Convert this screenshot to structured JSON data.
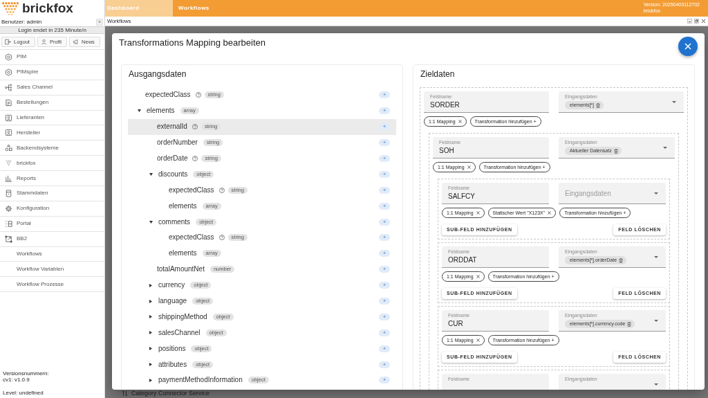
{
  "sidebar": {
    "logo": "brickfox",
    "user": "Benutzer: admin",
    "collapse": "«",
    "session": "Login endet in 235 Minute/n",
    "buttons": [
      "Logout",
      "Profil",
      "News"
    ],
    "nav": [
      {
        "label": "PIM",
        "selected": false
      },
      {
        "label": "PIMspire",
        "selected": false
      },
      {
        "label": "Sales Channel",
        "selected": false
      },
      {
        "label": "Bestellungen",
        "selected": false
      },
      {
        "label": "Lieferanten",
        "selected": false
      },
      {
        "label": "Hersteller",
        "selected": false
      },
      {
        "label": "Backendsysteme",
        "selected": false
      },
      {
        "label": "brickfox",
        "selected": false
      },
      {
        "label": "Reports",
        "selected": false
      },
      {
        "label": "Stammdaten",
        "selected": false
      },
      {
        "label": "Konfiguration",
        "selected": false
      },
      {
        "label": "Portal",
        "selected": false
      },
      {
        "label": "BB2",
        "selected": false
      },
      {
        "label": "Workflows",
        "selected": false
      },
      {
        "label": "Workflow Variablen",
        "selected": false
      },
      {
        "label": "Workflow Prozesse",
        "selected": false
      }
    ],
    "versions": [
      "Versionsnummern:",
      "cv1: v1.0.9"
    ],
    "level_info": "Level: undefined"
  },
  "top_bar": {
    "tabs": [
      {
        "label": "Dashboard",
        "selected": false
      },
      {
        "label": "Workflows",
        "selected": true
      }
    ],
    "version": "Version: 20250403112702",
    "brand": "brickfox"
  },
  "window": {
    "title": "Workflows"
  },
  "page": {
    "footer_item": "Category Connector Service"
  },
  "modal": {
    "title": "Transformations Mapping bearbeiten",
    "source": {
      "title": "Ausgangsdaten",
      "tree": [
        {
          "name": "expectedClass",
          "type": "string",
          "kind": "leaf",
          "help": true,
          "selected": false,
          "add": "+"
        },
        {
          "name": "elements",
          "type": "array",
          "kind": "branch",
          "expanded": true,
          "help": false,
          "selected": false,
          "add": "+",
          "children": [
            {
              "name": "externalId",
              "type": "string",
              "kind": "leaf",
              "help": true,
              "selected": true,
              "add": "+"
            },
            {
              "name": "orderNumber",
              "type": "string",
              "kind": "leaf",
              "help": false,
              "selected": false,
              "add": "+"
            },
            {
              "name": "orderDate",
              "type": "string",
              "kind": "leaf",
              "help": true,
              "selected": false,
              "add": "+"
            },
            {
              "name": "discounts",
              "type": "object",
              "kind": "branch",
              "expanded": true,
              "help": false,
              "selected": false,
              "add": "+",
              "children": [
                {
                  "name": "expectedClass",
                  "type": "string",
                  "kind": "leaf",
                  "help": true,
                  "selected": false,
                  "add": "+"
                },
                {
                  "name": "elements",
                  "type": "array",
                  "kind": "leaf",
                  "help": false,
                  "selected": false,
                  "add": "+"
                }
              ]
            },
            {
              "name": "comments",
              "type": "object",
              "kind": "branch",
              "expanded": true,
              "help": false,
              "selected": false,
              "add": "+",
              "children": [
                {
                  "name": "expectedClass",
                  "type": "string",
                  "kind": "leaf",
                  "help": true,
                  "selected": false,
                  "add": "+"
                },
                {
                  "name": "elements",
                  "type": "array",
                  "kind": "leaf",
                  "help": false,
                  "selected": false,
                  "add": "+"
                }
              ]
            },
            {
              "name": "totalAmountNet",
              "type": "number",
              "kind": "leaf",
              "help": false,
              "selected": false,
              "add": "+"
            },
            {
              "name": "currency",
              "type": "object",
              "kind": "branch",
              "expanded": false,
              "help": false,
              "selected": false,
              "add": "+"
            },
            {
              "name": "language",
              "type": "object",
              "kind": "branch",
              "expanded": false,
              "help": false,
              "selected": false,
              "add": "+"
            },
            {
              "name": "shippingMethod",
              "type": "object",
              "kind": "branch",
              "expanded": false,
              "help": false,
              "selected": false,
              "add": "+"
            },
            {
              "name": "salesChannel",
              "type": "object",
              "kind": "branch",
              "expanded": false,
              "help": false,
              "selected": false,
              "add": "+"
            },
            {
              "name": "positions",
              "type": "object",
              "kind": "branch",
              "expanded": false,
              "help": false,
              "selected": false,
              "add": "+"
            },
            {
              "name": "attributes",
              "type": "object",
              "kind": "branch",
              "expanded": false,
              "help": false,
              "selected": false,
              "add": "+"
            },
            {
              "name": "paymentMethodInformation",
              "type": "object",
              "kind": "branch",
              "expanded": false,
              "help": false,
              "selected": false,
              "add": "+"
            }
          ]
        }
      ]
    },
    "target": {
      "title": "Zieldaten",
      "fields": [
        {
          "field_label": "Feldname",
          "name": "SORDER",
          "source_label": "Eingangsdaten",
          "source_filled": true,
          "source_chip": "elements[*]",
          "transforms": [
            {
              "label": "1:1 Mapping",
              "kind": "removable"
            },
            {
              "label": "Transformation hinzufügen +",
              "kind": "add"
            }
          ],
          "children": [
            {
              "field_label": "Feldname",
              "name": "SOH",
              "source_label": "Eingangsdaten",
              "source_filled": true,
              "source_chip": "Aktueller Datensatz",
              "transforms": [
                {
                  "label": "1:1 Mapping",
                  "kind": "removable"
                },
                {
                  "label": "Transformation hinzufügen +",
                  "kind": "add"
                }
              ],
              "children": [
                {
                  "field_label": "Feldname",
                  "name": "SALFCY",
                  "source_label": "Eingangsdaten",
                  "source_filled": false,
                  "transforms": [
                    {
                      "label": "1:1 Mapping",
                      "kind": "removable"
                    },
                    {
                      "label": "Statischer Wert \"X123X\"",
                      "kind": "removable"
                    },
                    {
                      "label": "Transformation hinzufügen +",
                      "kind": "add"
                    }
                  ],
                  "buttons": [
                    "SUB-FELD HINZUFÜGEN",
                    "FELD LÖSCHEN"
                  ]
                },
                {
                  "field_label": "Feldname",
                  "name": "ORDDAT",
                  "source_label": "Eingangsdaten",
                  "source_filled": true,
                  "source_chip": "elements[*].orderDate",
                  "transforms": [
                    {
                      "label": "1:1 Mapping",
                      "kind": "removable"
                    },
                    {
                      "label": "Transformation hinzufügen +",
                      "kind": "add"
                    }
                  ],
                  "buttons": [
                    "SUB-FELD HINZUFÜGEN",
                    "FELD LÖSCHEN"
                  ]
                },
                {
                  "field_label": "Feldname",
                  "name": "CUR",
                  "source_label": "Eingangsdaten",
                  "source_filled": true,
                  "source_chip": "elements[*].currency.code",
                  "transforms": [
                    {
                      "label": "1:1 Mapping",
                      "kind": "removable"
                    },
                    {
                      "label": "Transformation hinzufügen +",
                      "kind": "add"
                    }
                  ],
                  "buttons": [
                    "SUB-FELD HINZUFÜGEN",
                    "FELD LÖSCHEN"
                  ]
                },
                {
                  "field_label": "Feldname",
                  "source_label": "Eingangsdaten",
                  "source_filled": true
                }
              ]
            }
          ]
        }
      ]
    }
  }
}
